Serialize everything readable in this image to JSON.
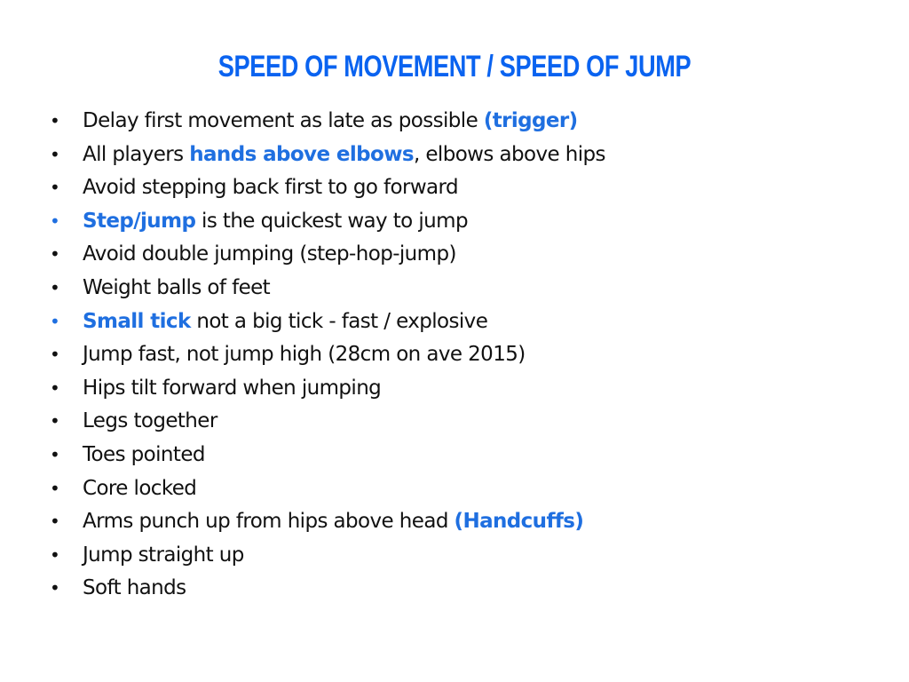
{
  "slide": {
    "title": "SPEED OF MOVEMENT / SPEED OF JUMP",
    "colors": {
      "title": "#0a63f0",
      "highlight": "#1f6fe0",
      "text": "#111111"
    },
    "bullets": [
      {
        "pre": "Delay first movement as late as possible ",
        "highlight": "(trigger)",
        "post": "",
        "blue_bullet": false
      },
      {
        "pre": "All players ",
        "highlight": "hands above elbows",
        "post": ", elbows above hips",
        "blue_bullet": false
      },
      {
        "pre": "Avoid stepping back first to go forward",
        "highlight": "",
        "post": "",
        "blue_bullet": false
      },
      {
        "pre": "",
        "highlight": "Step/jump",
        "post": " is the quickest way to jump",
        "blue_bullet": true
      },
      {
        "pre": "Avoid double jumping (step-hop-jump)",
        "highlight": "",
        "post": "",
        "blue_bullet": false
      },
      {
        "pre": "Weight balls of feet",
        "highlight": "",
        "post": "",
        "blue_bullet": false
      },
      {
        "pre": "",
        "highlight": "Small tick",
        "post": " not a big tick - fast / explosive",
        "blue_bullet": true
      },
      {
        "pre": "Jump fast, not jump high (28cm on ave 2015)",
        "highlight": "",
        "post": "",
        "blue_bullet": false
      },
      {
        "pre": "Hips tilt forward when jumping",
        "highlight": "",
        "post": "",
        "blue_bullet": false
      },
      {
        "pre": "Legs together",
        "highlight": "",
        "post": "",
        "blue_bullet": false
      },
      {
        "pre": "Toes pointed",
        "highlight": "",
        "post": "",
        "blue_bullet": false
      },
      {
        "pre": "Core locked",
        "highlight": "",
        "post": "",
        "blue_bullet": false
      },
      {
        "pre": "Arms punch up from hips above head ",
        "highlight": "(Handcuffs)",
        "post": "",
        "blue_bullet": false
      },
      {
        "pre": "Jump straight up",
        "highlight": "",
        "post": "",
        "blue_bullet": false
      },
      {
        "pre": "Soft hands",
        "highlight": "",
        "post": "",
        "blue_bullet": false
      }
    ],
    "bullet_glyph": "•"
  }
}
